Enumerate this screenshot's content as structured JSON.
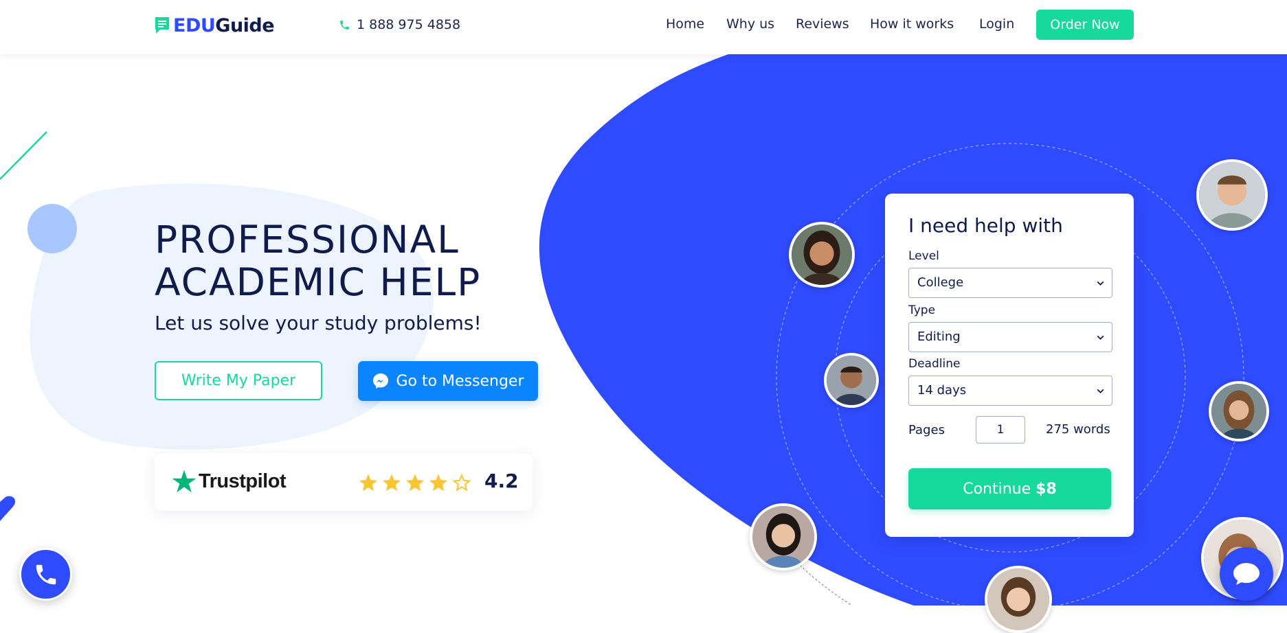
{
  "header": {
    "logo": {
      "part1": "EDU",
      "part2": "Guide"
    },
    "phone": "1 888 975 4858",
    "nav": [
      "Home",
      "Why us",
      "Reviews",
      "How it works",
      "Login"
    ],
    "cta": "Order Now"
  },
  "hero": {
    "title_line1": "PROFESSIONAL",
    "title_line2": "ACADEMIC HELP",
    "subtitle": "Let us solve your study problems!",
    "write_button": "Write My Paper",
    "messenger_button": "Go to Messenger"
  },
  "trustpilot": {
    "brand": "Trustpilot",
    "stars": 4,
    "rating": "4.2"
  },
  "form": {
    "title": "I need help with",
    "level": {
      "label": "Level",
      "value": "College"
    },
    "type": {
      "label": "Type",
      "value": "Editing"
    },
    "deadline": {
      "label": "Deadline",
      "value": "14 days"
    },
    "pages": {
      "label": "Pages",
      "value": "1",
      "words": "275 words"
    },
    "continue": {
      "label": "Continue",
      "price": "$8"
    }
  },
  "colors": {
    "brand_blue": "#2f4bff",
    "accent_green": "#16d99b",
    "messenger_blue": "#0b84ff",
    "text_dark": "#0f1b4c",
    "star_yellow": "#fbc531"
  },
  "icons": {
    "logo": "chat-document-icon",
    "phone": "phone-icon",
    "messenger": "messenger-icon",
    "trustpilot": "trustpilot-star-icon",
    "select": "chevron-down-icon",
    "call_fab": "phone-icon",
    "chat_fab": "chat-bubble-icon"
  }
}
